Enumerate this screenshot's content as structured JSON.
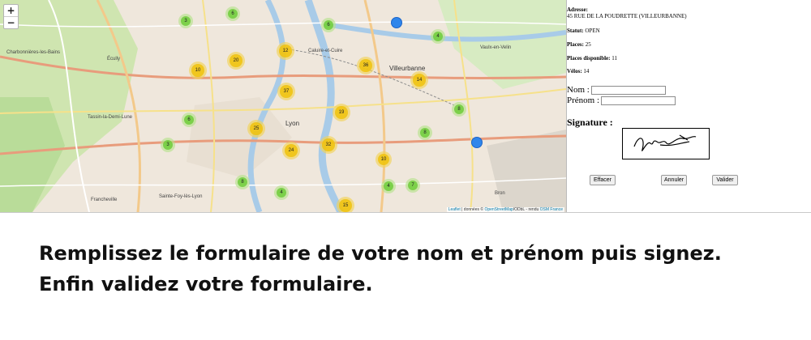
{
  "map": {
    "zoom_in": "+",
    "zoom_out": "−",
    "clusters": [
      {
        "label": "3",
        "color": "green"
      },
      {
        "label": "6",
        "color": "green"
      },
      {
        "label": "6",
        "color": "green"
      },
      {
        "label": "4",
        "color": "green"
      },
      {
        "label": "12",
        "color": "yellow"
      },
      {
        "label": "20",
        "color": "yellow"
      },
      {
        "label": "10",
        "color": "yellow"
      },
      {
        "label": "36",
        "color": "yellow"
      },
      {
        "label": "14",
        "color": "yellow"
      },
      {
        "label": "37",
        "color": "yellow"
      },
      {
        "label": "19",
        "color": "yellow"
      },
      {
        "label": "8",
        "color": "green"
      },
      {
        "label": "6",
        "color": "green"
      },
      {
        "label": "25",
        "color": "yellow"
      },
      {
        "label": "8",
        "color": "green"
      },
      {
        "label": "3",
        "color": "green"
      },
      {
        "label": "24",
        "color": "yellow"
      },
      {
        "label": "32",
        "color": "yellow"
      },
      {
        "label": "10",
        "color": "yellow"
      },
      {
        "label": "8",
        "color": "green"
      },
      {
        "label": "4",
        "color": "green"
      },
      {
        "label": "4",
        "color": "green"
      },
      {
        "label": "7",
        "color": "green"
      },
      {
        "label": "15",
        "color": "yellow"
      }
    ],
    "places": [
      "Villeurbanne",
      "Lyon",
      "Charbonnières-les-Bains",
      "Écully",
      "Tassin-la-Demi-Lune",
      "Francheville",
      "Sainte-Foy-lès-Lyon",
      "Vaulx-en-Velin",
      "Bron",
      "Caluire-et-Cuire"
    ],
    "attribution_leaflet": "Leaflet",
    "attribution_text": " | données © ",
    "attribution_osm": "OpenStreetMap",
    "attribution_text2": "/ODbL - rendu ",
    "attribution_osmfr": "OSM France"
  },
  "station": {
    "address_label": "Adresse:",
    "address_value": "45 RUE DE LA POUDRETTE (VILLEURBANNE)",
    "status_label": "Statut:",
    "status_value": "OPEN",
    "places_label": "Places:",
    "places_value": "25",
    "available_label": "Places disponible:",
    "available_value": "11",
    "bikes_label": "Vélos:",
    "bikes_value": "14"
  },
  "form": {
    "nom_label": "Nom :",
    "nom_value": "",
    "prenom_label": "Prénom :",
    "prenom_value": "",
    "signature_label": "Signature :",
    "clear_button": "Effacer",
    "cancel_button": "Annuler",
    "validate_button": "Valider"
  },
  "instructions": {
    "line1": "Remplissez le formulaire de votre nom et prénom puis signez.",
    "line2": "Enfin validez votre formulaire."
  }
}
